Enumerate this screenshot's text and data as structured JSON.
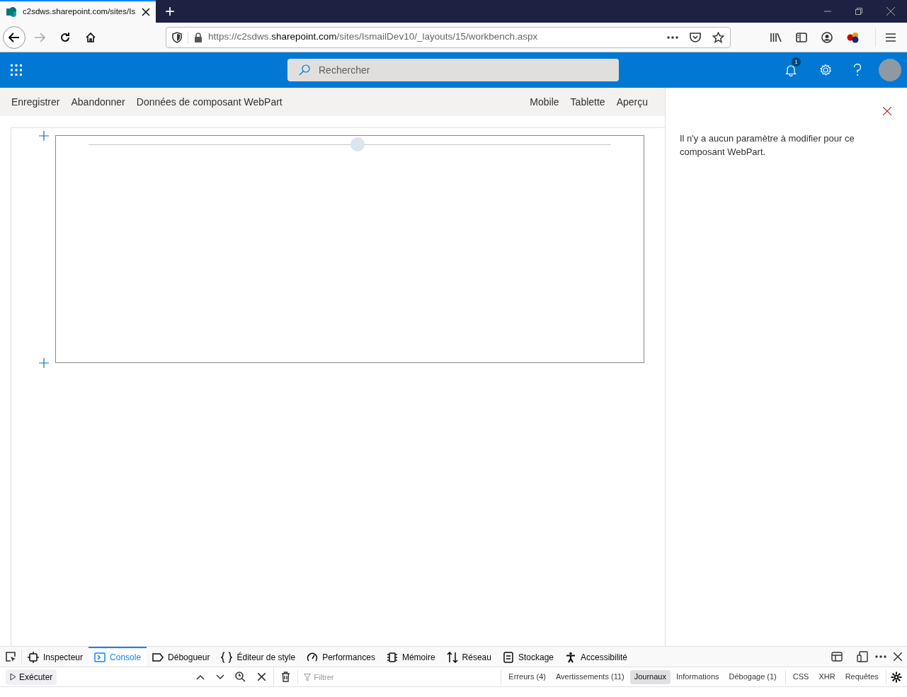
{
  "browser": {
    "tab_title": "c2sdws.sharepoint.com/sites/Is",
    "new_tab": "+",
    "url": {
      "scheme": "https://c2sdws.",
      "domain": "sharepoint.com",
      "path": "/sites/IsmailDev10/_layouts/15/workbench.aspx"
    }
  },
  "suite_bar": {
    "search": {
      "placeholder": "Rechercher"
    },
    "notification_count": "1"
  },
  "command_bar": {
    "left": [
      "Enregistrer",
      "Abandonner",
      "Données de composant WebPart"
    ],
    "right": [
      "Mobile",
      "Tablette",
      "Aperçu"
    ]
  },
  "property_pane": {
    "message": "Il n'y a aucun paramètre à modifier pour ce composant WebPart."
  },
  "devtools": {
    "tabs": [
      {
        "label": "Inspecteur",
        "selected": false
      },
      {
        "label": "Console",
        "selected": true
      },
      {
        "label": "Débogueur",
        "selected": false
      },
      {
        "label": "Éditeur de style",
        "selected": false
      },
      {
        "label": "Performances",
        "selected": false
      },
      {
        "label": "Mémoire",
        "selected": false
      },
      {
        "label": "Réseau",
        "selected": false
      },
      {
        "label": "Stockage",
        "selected": false
      },
      {
        "label": "Accessibilité",
        "selected": false
      }
    ],
    "run_button": "Exécuter",
    "filter": {
      "placeholder": "Filtrer"
    },
    "levels": [
      {
        "label": "Erreurs (4)",
        "selected": false
      },
      {
        "label": "Avertissements (11)",
        "selected": false
      },
      {
        "label": "Journaux",
        "selected": true
      },
      {
        "label": "Informations",
        "selected": false
      },
      {
        "label": "Débogage (1)",
        "selected": false
      }
    ],
    "types": [
      {
        "label": "CSS",
        "selected": false
      },
      {
        "label": "XHR",
        "selected": false
      },
      {
        "label": "Requêtes",
        "selected": false
      }
    ]
  }
}
